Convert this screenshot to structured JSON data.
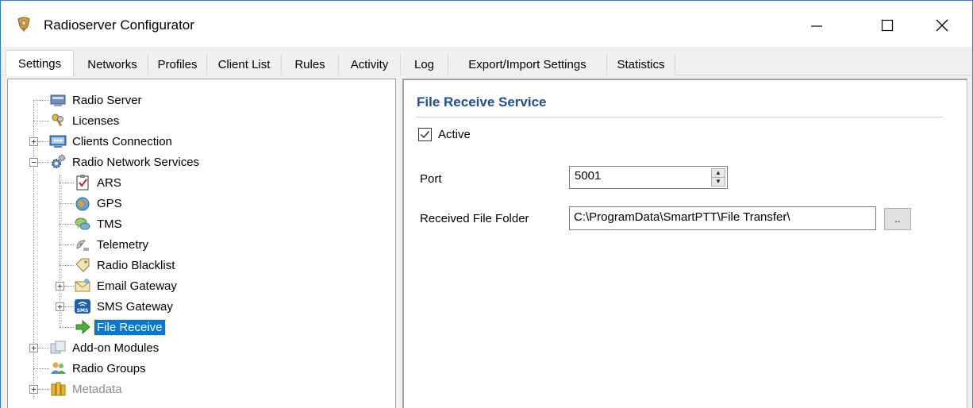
{
  "window": {
    "title": "Radioserver Configurator",
    "minimize_glyph": "—",
    "maximize_glyph": "☐",
    "close_glyph": "✕"
  },
  "tabs": [
    {
      "label": "Settings",
      "active": true
    },
    {
      "label": "Networks"
    },
    {
      "label": "Profiles"
    },
    {
      "label": "Client List"
    },
    {
      "label": "Rules"
    },
    {
      "label": "Activity"
    },
    {
      "label": "Log"
    },
    {
      "label": "Export/Import Settings"
    },
    {
      "label": "Statistics"
    }
  ],
  "tree": {
    "items": [
      {
        "label": "Radio Server",
        "icon": "server-icon"
      },
      {
        "label": "Licenses",
        "icon": "keys-icon"
      },
      {
        "label": "Clients Connection",
        "icon": "network-icon"
      },
      {
        "label": "Radio Network Services",
        "icon": "gears-icon"
      },
      {
        "label": "ARS",
        "icon": "clipboard-check-icon"
      },
      {
        "label": "GPS",
        "icon": "globe-icon"
      },
      {
        "label": "TMS",
        "icon": "chat-icon"
      },
      {
        "label": "Telemetry",
        "icon": "satellite-icon"
      },
      {
        "label": "Radio Blacklist",
        "icon": "tag-icon"
      },
      {
        "label": "Email Gateway",
        "icon": "envelope-icon"
      },
      {
        "label": "SMS Gateway",
        "icon": "sms-icon"
      },
      {
        "label": "File Receive",
        "icon": "arrow-right-icon",
        "selected": true
      },
      {
        "label": "Add-on Modules",
        "icon": "modules-icon"
      },
      {
        "label": "Radio Groups",
        "icon": "users-icon"
      },
      {
        "label": "Metadata",
        "icon": "database-icon",
        "disabled": true
      }
    ],
    "expander_plus": "+",
    "expander_minus": "−"
  },
  "panel": {
    "title": "File Receive Service",
    "active_label": "Active",
    "active_checked": true,
    "port_label": "Port",
    "port_value": "5001",
    "folder_label": "Received File Folder",
    "folder_value": "C:\\ProgramData\\SmartPTT\\File Transfer\\",
    "browse_label": ".."
  },
  "colors": {
    "section_title": "#1e4e8c",
    "selection": "#0078d7",
    "window_border": "#2b7bd3"
  }
}
